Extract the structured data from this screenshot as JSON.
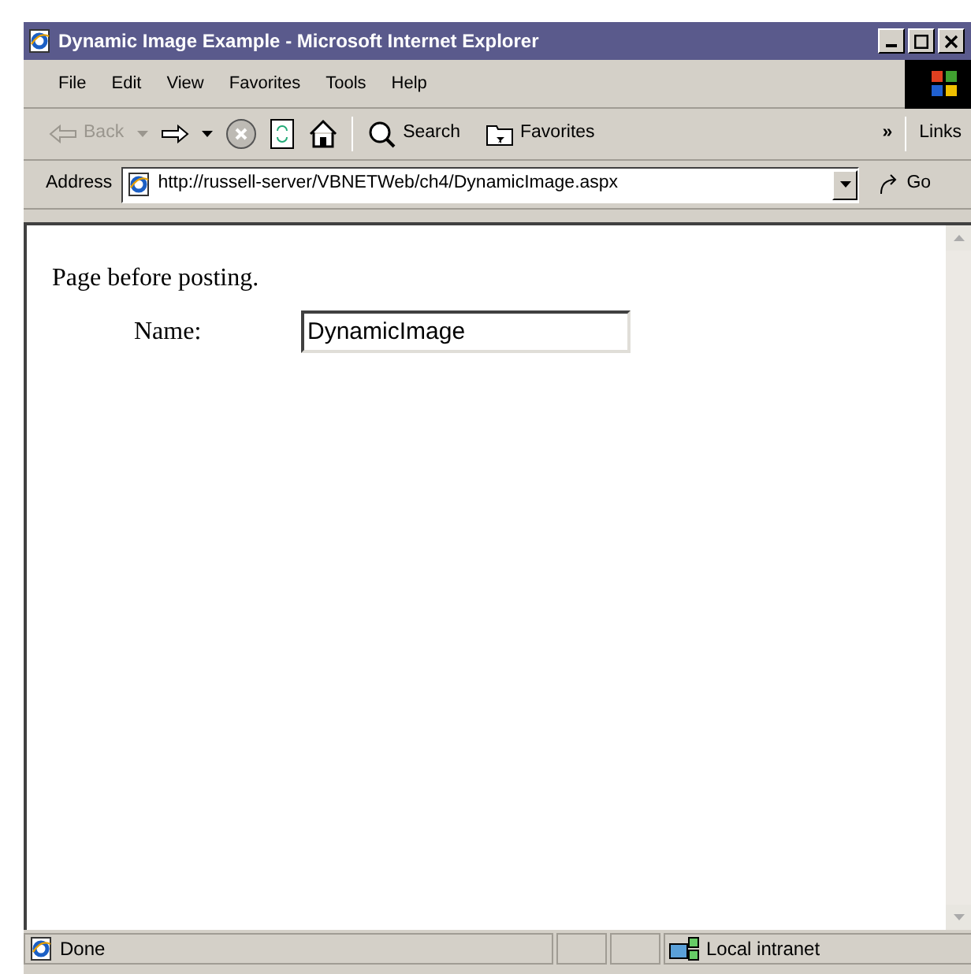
{
  "window": {
    "title": "Dynamic Image Example - Microsoft Internet Explorer"
  },
  "menu": [
    "File",
    "Edit",
    "View",
    "Favorites",
    "Tools",
    "Help"
  ],
  "toolbar": {
    "back": "Back",
    "search": "Search",
    "favorites": "Favorites",
    "chevron": "»",
    "links": "Links"
  },
  "address": {
    "label": "Address",
    "url": "http://russell-server/VBNETWeb/ch4/DynamicImage.aspx",
    "go": "Go"
  },
  "page": {
    "heading": "Page before posting.",
    "field_label": "Name:",
    "field_value": "DynamicImage"
  },
  "status_bar": {
    "text": "Done",
    "zone": "Local intranet"
  }
}
